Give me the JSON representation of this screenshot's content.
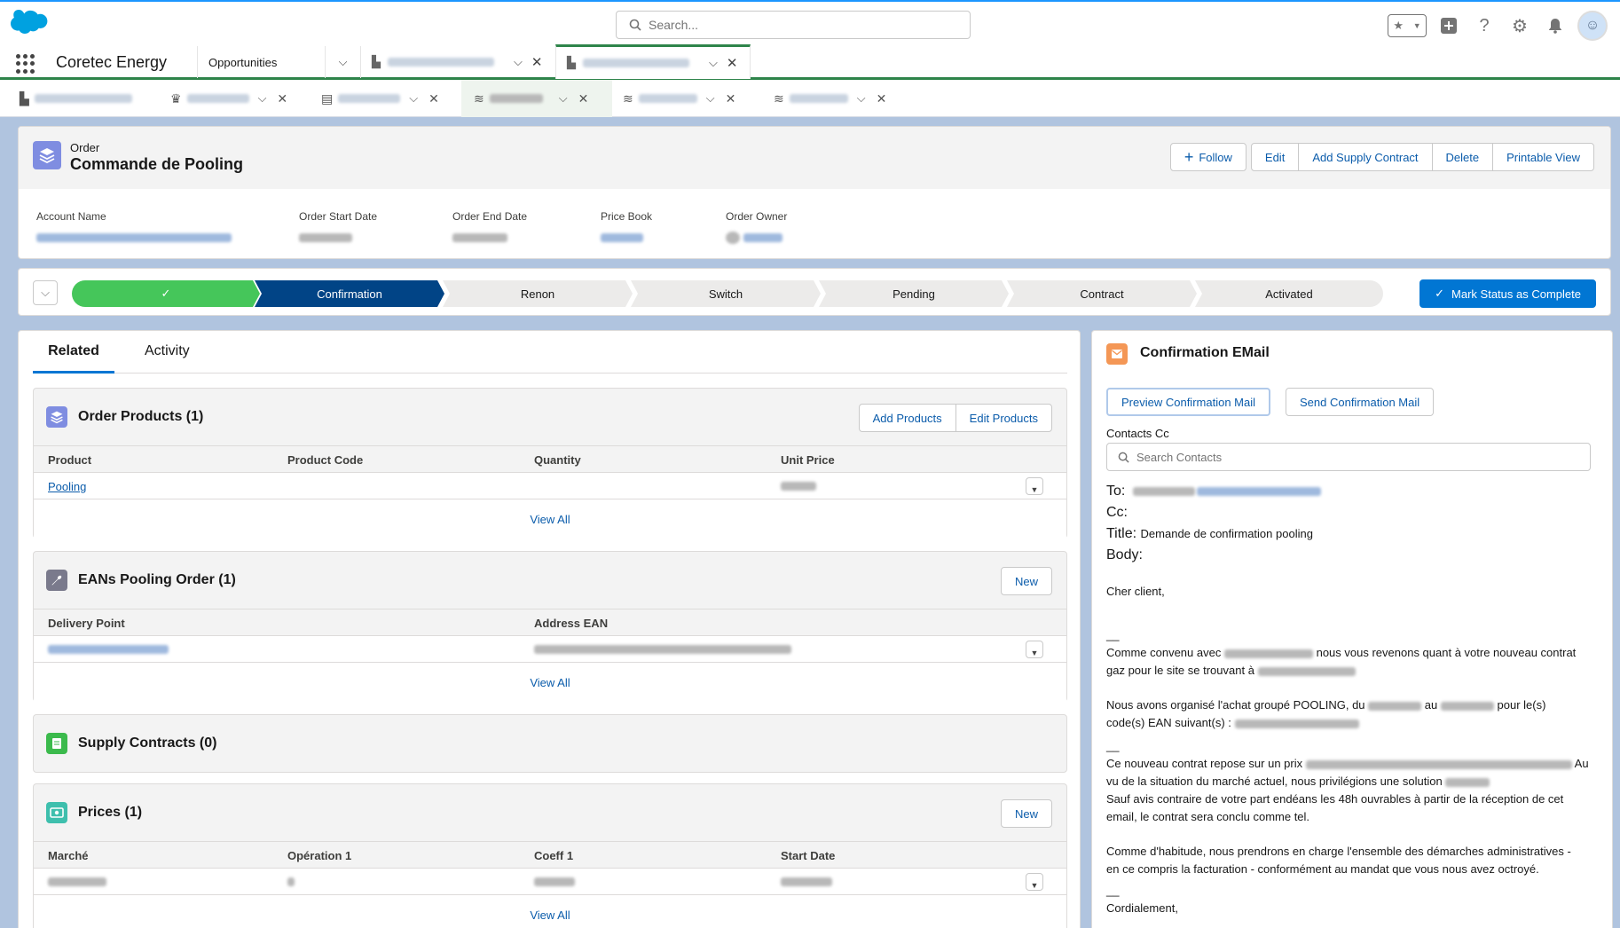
{
  "global_header": {
    "search_placeholder": "Search..."
  },
  "nav": {
    "app_name": "Coretec Energy",
    "items": [
      {
        "label": "Opportunities"
      }
    ]
  },
  "highlights": {
    "object_label": "Order",
    "record_title": "Commande de Pooling",
    "actions": {
      "follow": "Follow",
      "edit": "Edit",
      "add_supply_contract": "Add Supply Contract",
      "delete": "Delete",
      "printable_view": "Printable View"
    },
    "fields": [
      {
        "label": "Account Name"
      },
      {
        "label": "Order Start Date"
      },
      {
        "label": "Order End Date"
      },
      {
        "label": "Price Book"
      },
      {
        "label": "Order Owner"
      }
    ]
  },
  "path": {
    "steps": [
      "Confirmation",
      "Renon",
      "Switch",
      "Pending",
      "Contract",
      "Activated"
    ],
    "mark_complete": "Mark Status as Complete"
  },
  "tabs": {
    "related": "Related",
    "activity": "Activity"
  },
  "order_products": {
    "title": "Order Products (1)",
    "add": "Add Products",
    "edit": "Edit Products",
    "columns": [
      "Product",
      "Product Code",
      "Quantity",
      "Unit Price"
    ],
    "row_product": "Pooling",
    "view_all": "View All"
  },
  "eans": {
    "title": "EANs Pooling Order (1)",
    "new": "New",
    "columns": [
      "Delivery Point",
      "Address EAN"
    ],
    "view_all": "View All"
  },
  "supply_contracts": {
    "title": "Supply Contracts (0)"
  },
  "prices": {
    "title": "Prices (1)",
    "new": "New",
    "columns": [
      "Marché",
      "Opération 1",
      "Coeff 1",
      "Start Date"
    ],
    "view_all": "View All"
  },
  "email": {
    "title": "Confirmation EMail",
    "preview": "Preview Confirmation Mail",
    "send": "Send Confirmation Mail",
    "contacts_cc": "Contacts Cc",
    "search_contacts": "Search Contacts",
    "to": "To:",
    "cc": "Cc:",
    "title_label": "Title:",
    "title_value": "Demande de confirmation pooling",
    "body_label": "Body:",
    "greeting": "Cher client,",
    "line1a": "Comme convenu avec",
    "line1b": "nous vous revenons quant à votre nouveau contrat",
    "line1c": "gaz pour le site se trouvant à",
    "line2a": "Nous avons organisé l'achat groupé POOLING, du",
    "line2b": "au",
    "line2c": "pour le(s)",
    "line2d": "code(s) EAN suivant(s) :",
    "line3a": "Ce nouveau contrat repose sur un prix",
    "line3b": "Au",
    "line3c": "vu de la situation du marché actuel, nous privilégions une solution",
    "line3d": "Sauf avis contraire de votre part endéans les 48h ouvrables à partir de la réception de cet",
    "line3e": "email, le contrat sera conclu comme tel.",
    "line4a": "Comme d'habitude, nous prendrons en charge l'ensemble des démarches administratives -",
    "line4b": "en ce compris la facturation - conformément au mandat que vous nous avez octroyé.",
    "closing": "Cordialement,",
    "separator": "__"
  },
  "colors": {
    "brand": "#0176d3",
    "path_complete": "#45c65a",
    "path_current": "#014486",
    "nav_active": "#2e844a"
  }
}
